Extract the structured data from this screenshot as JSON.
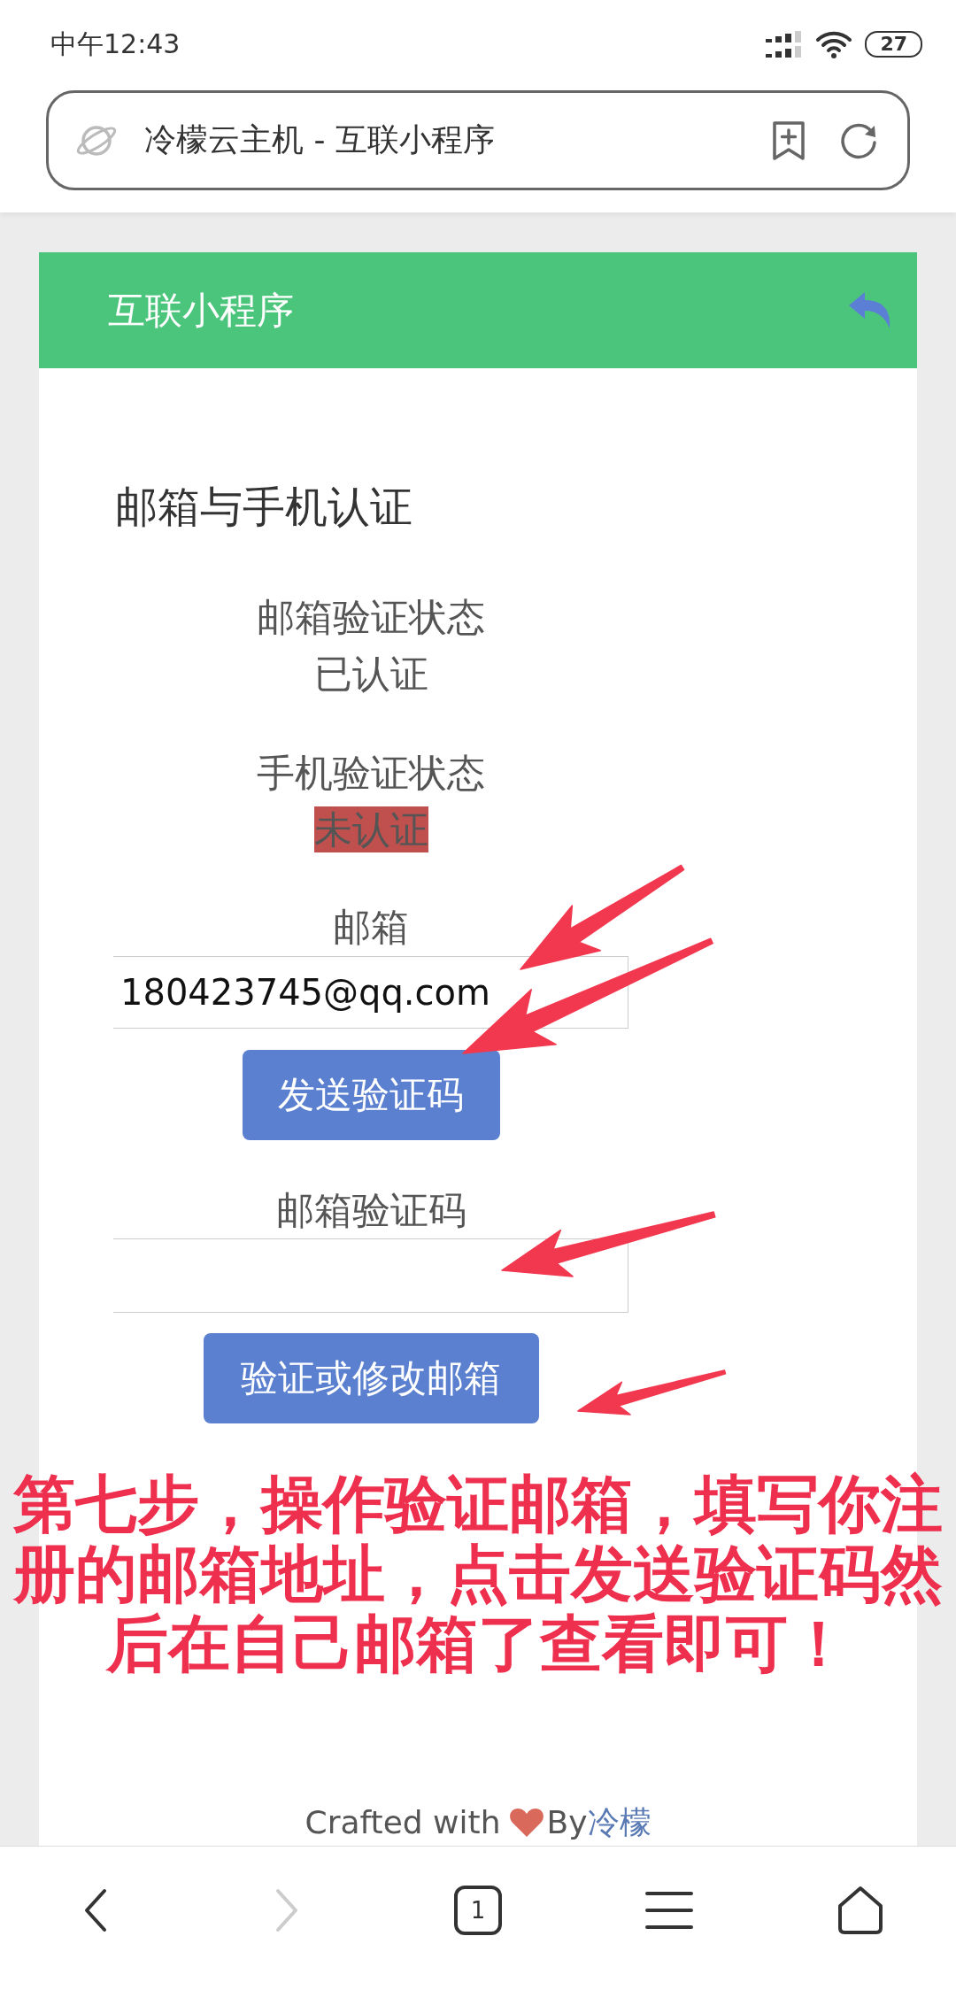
{
  "status_bar": {
    "time": "中午12:43",
    "battery": "27"
  },
  "address_bar": {
    "title": "冷檬云主机 - 互联小程序"
  },
  "header": {
    "title": "互联小程序"
  },
  "page": {
    "heading": "邮箱与手机认证",
    "statuses": [
      {
        "label": "邮箱验证状态",
        "value": "已认证",
        "verified": true
      },
      {
        "label": "手机验证状态",
        "value": "未认证",
        "verified": false
      }
    ],
    "email_field": {
      "label": "邮箱",
      "value": "180423745@qq.com"
    },
    "send_button": "发送验证码",
    "code_field": {
      "label": "邮箱验证码"
    },
    "submit_button": "验证或修改邮箱"
  },
  "annotation": {
    "text": "第七步，操作验证邮箱，填写你注册的邮箱地址，点击发送验证码然后在自己邮箱了查看即可！"
  },
  "footer": {
    "prefix": "Crafted with",
    "by": "By",
    "author": "冷檬"
  },
  "bottom_nav": [
    {
      "kind": "back",
      "disabled": false
    },
    {
      "kind": "forward",
      "disabled": true
    },
    {
      "kind": "tabs",
      "count": "1",
      "disabled": false
    },
    {
      "kind": "menu",
      "disabled": false
    },
    {
      "kind": "home",
      "disabled": false
    }
  ]
}
